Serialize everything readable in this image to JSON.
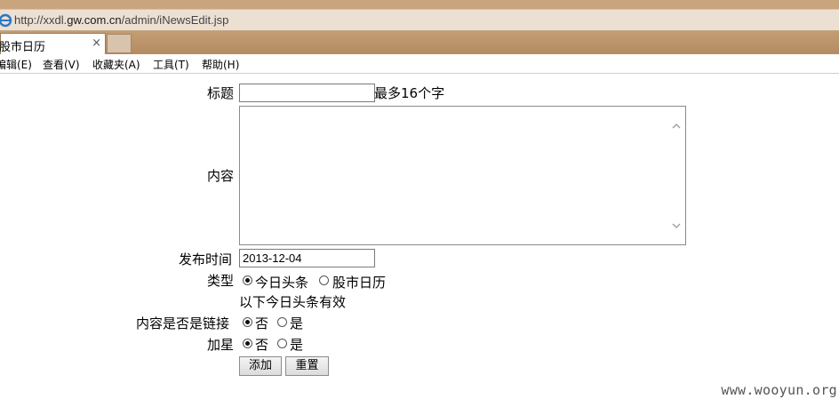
{
  "browser": {
    "url_prefix": "http://xxdl.",
    "url_domain": "gw.com.cn",
    "url_path": "/admin/iNewsEdit.jsp",
    "tab_title": "股市日历",
    "tab_close": "×",
    "menu": [
      "编辑(E)",
      "查看(V)",
      "收藏夹(A)",
      "工具(T)",
      "帮助(H)"
    ]
  },
  "form": {
    "title_label": "标题",
    "title_value": "",
    "title_hint": "最多16个字",
    "content_label": "内容",
    "content_value": "",
    "date_label": "发布时间",
    "date_value": "2013-12-04",
    "type_label": "类型",
    "type_options": [
      "今日头条",
      "股市日历"
    ],
    "type_selected": "今日头条",
    "note": "以下今日头条有效",
    "is_link_label": "内容是否是链接",
    "is_link_options": [
      "否",
      "是"
    ],
    "is_link_selected": "否",
    "star_label": "加星",
    "star_options": [
      "否",
      "是"
    ],
    "star_selected": "否",
    "add_button": "添加",
    "reset_button": "重置"
  },
  "watermark": "www.wooyun.org"
}
